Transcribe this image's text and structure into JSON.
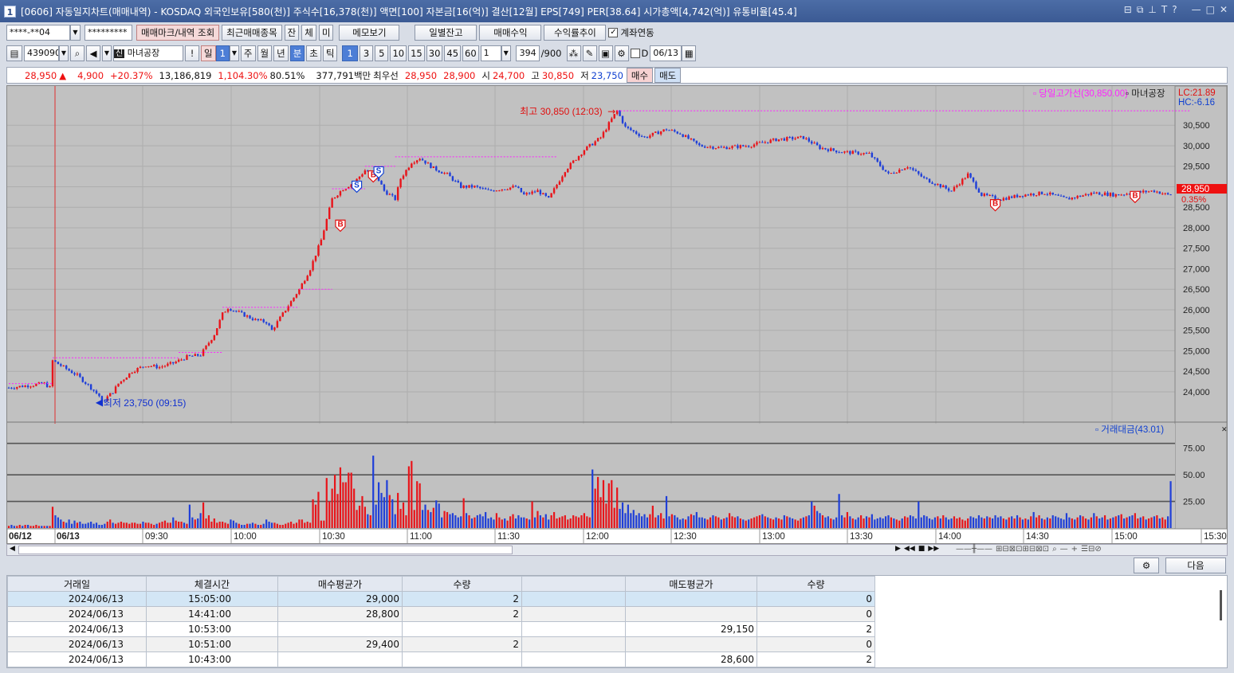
{
  "window": {
    "title": "[0606] 자동일지차트(매매내역) - KOSDAQ 외국인보유[580(천)] 주식수[16,378(천)] 액면[100] 자본금[16(억)] 결산[12월] EPS[749] PER[38.64] 시가총액[4,742(억)] 유통비율[45.4]",
    "icon": "1",
    "controls": [
      "⊟",
      "⧉",
      "⊥",
      "T",
      "?",
      "—",
      "□",
      "✕"
    ]
  },
  "toolbar1": {
    "account": "****-**04",
    "password": "*********",
    "btn_marks": "매매마크/내역 조회",
    "btn_recent": "최근매매종목",
    "btn_jan": "잔",
    "btn_che": "체",
    "btn_mi": "미",
    "btn_memo": "메모보기",
    "btn_daily": "일별잔고",
    "btn_pnl": "매매수익",
    "btn_return": "수익률추이",
    "chk_account_label": "계좌연동"
  },
  "toolbar2": {
    "code": "439090",
    "name": "마녀공장",
    "btn_excl": "!",
    "period_btns": [
      "일",
      "1",
      "주",
      "월",
      "년",
      "분",
      "초",
      "틱"
    ],
    "interval_btns": [
      "1",
      "3",
      "5",
      "10",
      "15",
      "30",
      "45",
      "60"
    ],
    "count_value": "1",
    "bars_value": "394",
    "bars_total": "/900",
    "chk_d": "D",
    "date": "06/13"
  },
  "info": {
    "price": "28,950",
    "arrow": "▲",
    "change": "4,900",
    "pct": "+20.37%",
    "volume": "13,186,819",
    "vol_pct": "1,104.30%",
    "ratio": "80.51%",
    "amount": "377,791백만",
    "best_label": "최우선",
    "ask": "28,950",
    "bid": "28,900",
    "open_label": "시",
    "open": "24,700",
    "high_label": "고",
    "high": "30,850",
    "low_label": "저",
    "low": "23,750",
    "buy_btn": "매수",
    "sell_btn": "매도"
  },
  "chart_data": {
    "type": "candlestick",
    "title": "마녀공장",
    "legend_upper": "당일고가선(30,850.00)",
    "legend_series": "마녀공장",
    "lc": "LC:21.89",
    "hc": "HC:-6.16",
    "last_price_label": "28,950",
    "last_pct_label": "0.35%",
    "high_annotation": "최고 30,850 (12:03)",
    "low_annotation": "최저 23,750 (09:15)",
    "ylim": [
      23300,
      31300
    ],
    "yticks": [
      "30,500",
      "30,000",
      "29,500",
      "29,000",
      "28,500",
      "28,000",
      "27,500",
      "27,000",
      "26,500",
      "26,000",
      "25,500",
      "25,000",
      "24,500",
      "24,000"
    ],
    "xticks": [
      "06/12",
      "06/13",
      "09:30",
      "10:00",
      "10:30",
      "11:00",
      "11:30",
      "12:00",
      "12:30",
      "13:00",
      "13:30",
      "14:00",
      "14:30",
      "15:00",
      "15:30:00"
    ],
    "price_path": [
      [
        0,
        24100
      ],
      [
        13,
        24200
      ],
      [
        15,
        24100
      ],
      [
        16,
        24760
      ],
      [
        25,
        24400
      ],
      [
        30,
        24100
      ],
      [
        33,
        23900
      ],
      [
        34,
        23750
      ],
      [
        38,
        24000
      ],
      [
        40,
        24200
      ],
      [
        45,
        24500
      ],
      [
        50,
        24650
      ],
      [
        55,
        24600
      ],
      [
        60,
        24700
      ],
      [
        65,
        24850
      ],
      [
        70,
        24900
      ],
      [
        75,
        25400
      ],
      [
        78,
        25900
      ],
      [
        80,
        26050
      ],
      [
        85,
        25900
      ],
      [
        90,
        25750
      ],
      [
        94,
        25700
      ],
      [
        96,
        25500
      ],
      [
        100,
        25900
      ],
      [
        104,
        26300
      ],
      [
        106,
        26500
      ],
      [
        110,
        27000
      ],
      [
        114,
        27700
      ],
      [
        118,
        28700
      ],
      [
        122,
        28950
      ],
      [
        126,
        29100
      ],
      [
        130,
        29400
      ],
      [
        134,
        29300
      ],
      [
        137,
        28900
      ],
      [
        141,
        28700
      ],
      [
        143,
        29200
      ],
      [
        147,
        29600
      ],
      [
        150,
        29700
      ],
      [
        155,
        29450
      ],
      [
        160,
        29300
      ],
      [
        165,
        29000
      ],
      [
        170,
        29000
      ],
      [
        175,
        28900
      ],
      [
        180,
        28950
      ],
      [
        185,
        29000
      ],
      [
        188,
        28800
      ],
      [
        193,
        28900
      ],
      [
        197,
        28700
      ],
      [
        203,
        29400
      ],
      [
        210,
        29900
      ],
      [
        216,
        30200
      ],
      [
        220,
        30650
      ],
      [
        222,
        30850
      ],
      [
        225,
        30450
      ],
      [
        232,
        30200
      ],
      [
        240,
        30400
      ],
      [
        245,
        30300
      ],
      [
        252,
        30000
      ],
      [
        260,
        29950
      ],
      [
        270,
        30000
      ],
      [
        280,
        30150
      ],
      [
        290,
        30200
      ],
      [
        296,
        29950
      ],
      [
        304,
        29850
      ],
      [
        314,
        29800
      ],
      [
        321,
        29300
      ],
      [
        328,
        29500
      ],
      [
        334,
        29200
      ],
      [
        339,
        29050
      ],
      [
        344,
        28900
      ],
      [
        350,
        29300
      ],
      [
        355,
        28800
      ],
      [
        362,
        28700
      ],
      [
        370,
        28800
      ],
      [
        378,
        28850
      ],
      [
        386,
        28700
      ],
      [
        396,
        28850
      ],
      [
        404,
        28800
      ],
      [
        410,
        28850
      ],
      [
        418,
        28900
      ],
      [
        423,
        28800
      ],
      [
        427,
        28850
      ],
      [
        431,
        28950
      ]
    ],
    "vol_yticks": [
      "75.00",
      "50.00",
      "25.00"
    ],
    "vol_legend": "거래대금(43.01)",
    "volume": [
      2,
      3,
      2,
      2,
      3,
      2,
      3,
      3,
      2,
      2,
      3,
      2,
      2,
      2,
      2,
      2,
      20,
      12,
      10,
      8,
      6,
      5,
      8,
      4,
      7,
      5,
      6,
      4,
      4,
      5,
      6,
      4,
      5,
      3,
      3,
      4,
      6,
      8,
      5,
      4,
      5,
      6,
      5,
      5,
      4,
      5,
      5,
      4,
      4,
      6,
      5,
      5,
      4,
      3,
      4,
      5,
      6,
      7,
      5,
      5,
      10,
      7,
      6,
      6,
      5,
      4,
      22,
      10,
      8,
      9,
      14,
      24,
      9,
      12,
      6,
      9,
      5,
      6,
      6,
      5,
      4,
      8,
      7,
      5,
      4,
      3,
      3,
      4,
      4,
      5,
      4,
      3,
      3,
      4,
      8,
      6,
      5,
      5,
      4,
      3,
      3,
      4,
      5,
      6,
      4,
      5,
      8,
      8,
      5,
      6,
      5,
      27,
      22,
      34,
      7,
      7,
      47,
      25,
      37,
      50,
      32,
      57,
      43,
      43,
      52,
      52,
      37,
      17,
      21,
      30,
      20,
      13,
      12,
      68,
      22,
      43,
      33,
      29,
      45,
      31,
      27,
      13,
      33,
      18,
      24,
      12,
      58,
      63,
      17,
      44,
      42,
      17,
      22,
      17,
      15,
      19,
      26,
      23,
      10,
      16,
      15,
      13,
      14,
      12,
      10,
      11,
      28,
      14,
      12,
      9,
      10,
      12,
      13,
      11,
      15,
      9,
      10,
      8,
      14,
      10,
      8,
      9,
      7,
      11,
      13,
      9,
      12,
      10,
      10,
      9,
      8,
      25,
      10,
      16,
      12,
      10,
      13,
      8,
      12,
      15,
      9,
      10,
      11,
      12,
      8,
      9,
      12,
      11,
      10,
      12,
      14,
      11,
      10,
      55,
      37,
      48,
      29,
      45,
      23,
      42,
      45,
      19,
      38,
      18,
      24,
      14,
      22,
      14,
      17,
      12,
      14,
      11,
      13,
      10,
      13,
      21,
      10,
      12,
      14,
      9,
      30,
      11,
      13,
      12,
      10,
      8,
      9,
      8,
      11,
      13,
      12,
      15,
      10,
      10,
      9,
      8,
      10,
      12,
      11,
      10,
      8,
      9,
      10,
      14,
      11,
      10,
      11,
      9,
      8,
      7,
      8,
      9,
      10,
      11,
      12,
      13,
      11,
      10,
      9,
      8,
      10,
      9,
      8,
      12,
      11,
      10,
      9,
      8,
      7,
      9,
      10,
      11,
      12,
      25,
      21,
      16,
      14,
      12,
      10,
      11,
      9,
      8,
      10,
      32,
      12,
      10,
      15,
      11,
      9,
      8,
      10,
      12,
      9,
      11,
      10,
      13,
      8,
      9,
      10,
      9,
      11,
      12,
      10,
      9,
      8,
      7,
      9,
      11,
      10,
      12,
      11,
      9,
      25,
      10,
      12,
      11,
      9,
      8,
      10,
      11,
      9,
      12,
      10,
      8,
      9,
      11,
      9,
      10,
      8,
      7,
      9,
      11,
      10,
      9,
      12,
      10,
      9,
      11,
      10,
      9,
      12,
      10,
      11,
      9,
      8,
      10,
      11,
      9,
      12,
      10,
      8,
      9,
      8,
      11,
      15,
      10,
      12,
      9,
      8,
      10,
      9,
      12,
      11,
      10,
      9,
      8,
      14,
      10,
      9,
      8,
      10,
      12,
      11,
      9,
      8,
      10,
      14,
      11,
      9,
      10,
      12,
      8,
      9,
      10,
      11,
      12,
      13,
      9,
      10,
      11,
      12,
      14,
      9,
      10,
      11,
      8,
      9,
      10,
      11,
      12,
      9,
      10,
      8,
      11,
      44
    ],
    "marks": [
      {
        "type": "B",
        "x": 121,
        "y": 28050
      },
      {
        "type": "S",
        "x": 127,
        "y": 29000
      },
      {
        "type": "B",
        "x": 133,
        "y": 29250
      },
      {
        "type": "S",
        "x": 135,
        "y": 29350
      },
      {
        "type": "B",
        "x": 360,
        "y": 28550
      },
      {
        "type": "B",
        "x": 411,
        "y": 28750
      }
    ]
  },
  "scroll_controls": [
    "▶",
    "◀◀",
    "■",
    "▶▶"
  ],
  "trades": {
    "btn_next": "다음",
    "headers": [
      "거래일",
      "체결시간",
      "매수평균가",
      "수량",
      "",
      "매도평균가",
      "수량"
    ],
    "rows": [
      [
        "2024/06/13",
        "15:05:00",
        "29,000",
        "2",
        "",
        "",
        "0"
      ],
      [
        "2024/06/13",
        "14:41:00",
        "28,800",
        "2",
        "",
        "",
        "0"
      ],
      [
        "2024/06/13",
        "10:53:00",
        "",
        "",
        "",
        "29,150",
        "2"
      ],
      [
        "2024/06/13",
        "10:51:00",
        "29,400",
        "2",
        "",
        "",
        "0"
      ],
      [
        "2024/06/13",
        "10:43:00",
        "",
        "",
        "",
        "28,600",
        "2"
      ]
    ]
  }
}
